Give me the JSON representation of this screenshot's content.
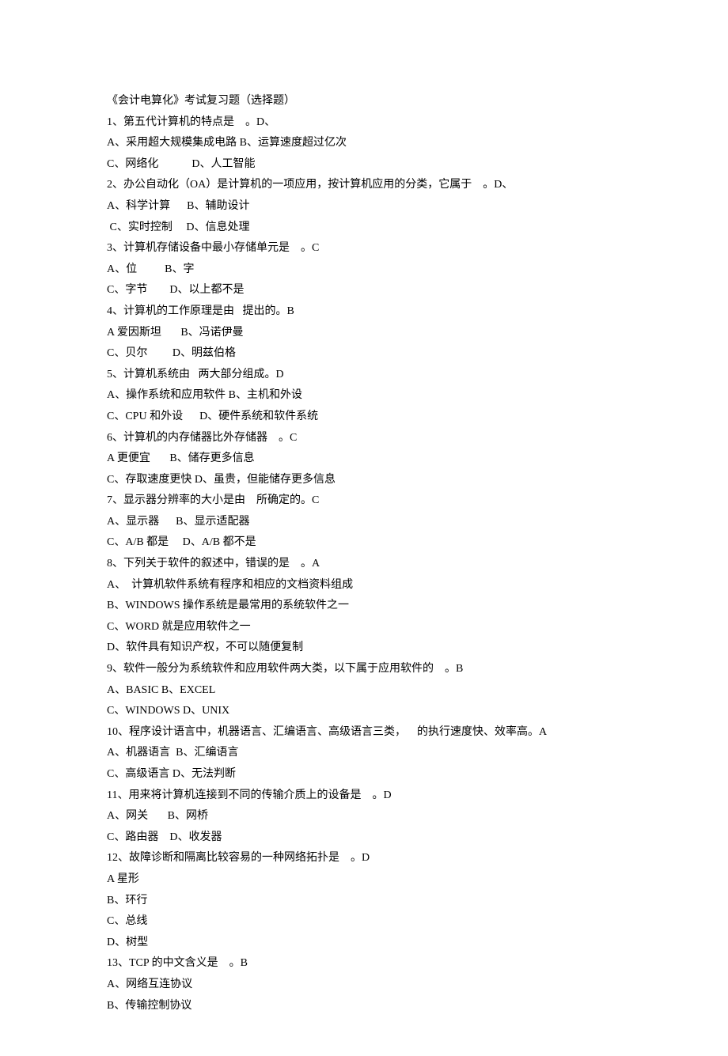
{
  "lines": [
    "《会计电算化》考试复习题（选择题）",
    "1、第五代计算机的特点是    。D、",
    "A、采用超大规模集成电路 B、运算速度超过亿次",
    "C、网络化            D、人工智能",
    "2、办公自动化（OA）是计算机的一项应用，按计算机应用的分类，它属于    。D、",
    "A、科学计算      B、辅助设计",
    " C、实时控制     D、信息处理",
    "3、计算机存储设备中最小存储单元是    。C",
    "A、位          B、字",
    "C、字节        D、以上都不是",
    "4、计算机的工作原理是由   提出的。B",
    "A 爱因斯坦       B、冯诺伊曼",
    "C、贝尔         D、明兹伯格",
    "5、计算机系统由   两大部分组成。D",
    "A、操作系统和应用软件 B、主机和外设",
    "C、CPU 和外设      D、硬件系统和软件系统",
    "6、计算机的内存储器比外存储器    。C",
    "A 更便宜       B、储存更多信息",
    "C、存取速度更快 D、虽贵，但能储存更多信息",
    "7、显示器分辨率的大小是由    所确定的。C",
    "A、显示器      B、显示适配器",
    "C、A/B 都是     D、A/B 都不是",
    "8、下列关于软件的叙述中，错误的是    。A",
    "A、  计算机软件系统有程序和相应的文档资料组成",
    "B、WINDOWS 操作系统是最常用的系统软件之一",
    "C、WORD 就是应用软件之一",
    "D、软件具有知识产权，不可以随便复制",
    "9、软件一般分为系统软件和应用软件两大类，以下属于应用软件的    。B",
    "A、BASIC B、EXCEL",
    "C、WINDOWS D、UNIX",
    "10、程序设计语言中，机器语言、汇编语言、高级语言三类，    的执行速度快、效率高。A",
    "A、机器语言  B、汇编语言",
    "C、高级语言 D、无法判断",
    "11、用来将计算机连接到不同的传输介质上的设备是    。D",
    "A、网关       B、网桥",
    "C、路由器    D、收发器",
    "12、故障诊断和隔离比较容易的一种网络拓扑是    。D",
    "A 星形",
    "B、环行",
    "C、总线",
    "D、树型",
    "13、TCP 的中文含义是    。B",
    "A、网络互连协议",
    "B、传输控制协议"
  ]
}
